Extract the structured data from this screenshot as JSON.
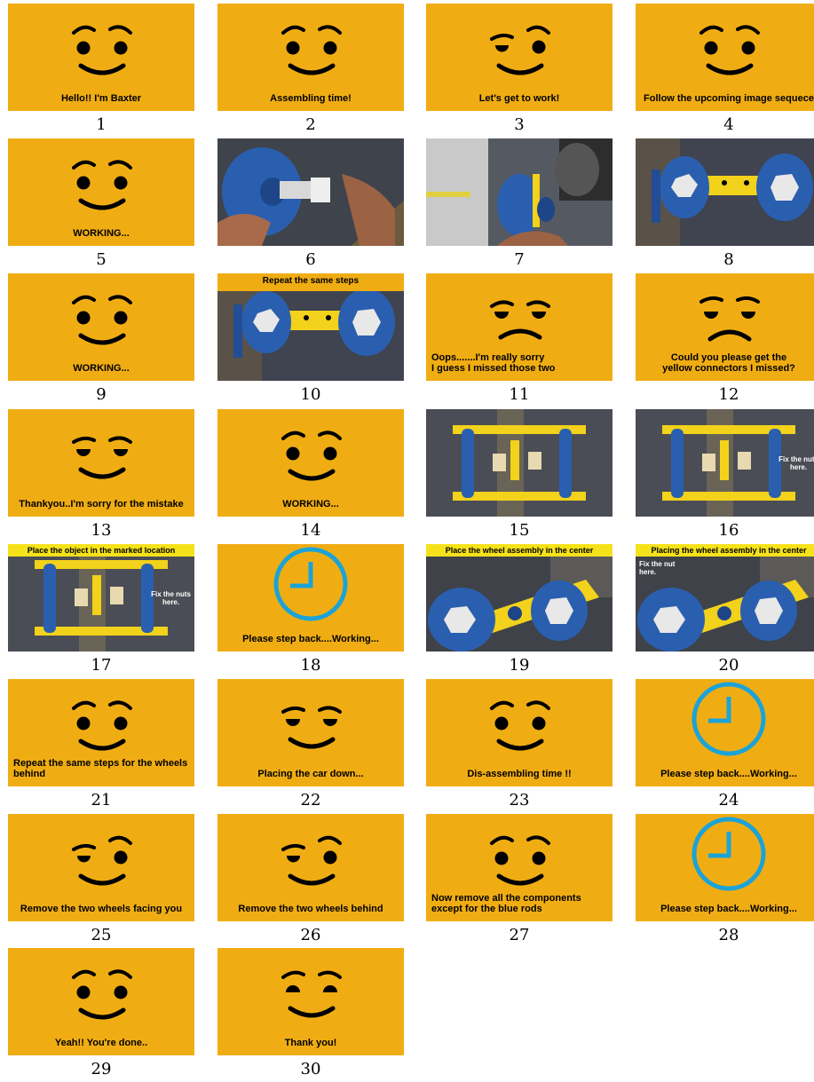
{
  "frames": [
    {
      "n": "1",
      "kind": "face",
      "expr": "happy",
      "caption": "Hello!! I'm Baxter"
    },
    {
      "n": "2",
      "kind": "face",
      "expr": "happy",
      "caption": "Assembling time!"
    },
    {
      "n": "3",
      "kind": "face",
      "expr": "wink",
      "caption": "Let's get to work!"
    },
    {
      "n": "4",
      "kind": "face",
      "expr": "happy",
      "caption": "Follow the upcoming image sequece"
    },
    {
      "n": "5",
      "kind": "face",
      "expr": "happy",
      "caption": "WORKING..."
    },
    {
      "n": "6",
      "kind": "photo",
      "scene": "wheel-bolt"
    },
    {
      "n": "7",
      "kind": "photo",
      "scene": "wheel-robot"
    },
    {
      "n": "8",
      "kind": "photo",
      "scene": "wheels-pair"
    },
    {
      "n": "9",
      "kind": "face",
      "expr": "happy",
      "caption": "WORKING..."
    },
    {
      "n": "10",
      "kind": "photo",
      "scene": "wheels-pair",
      "banner": "Repeat the same steps",
      "banner_style": "orange"
    },
    {
      "n": "11",
      "kind": "face",
      "expr": "sad",
      "caption": "Oops.......I'm really sorry\nI guess I missed those two",
      "align": "left"
    },
    {
      "n": "12",
      "kind": "face",
      "expr": "sad-closed",
      "caption": "Could you please get the\nyellow connectors I missed?"
    },
    {
      "n": "13",
      "kind": "face",
      "expr": "sheepish",
      "caption": "Thankyou..I'm sorry for the mistake"
    },
    {
      "n": "14",
      "kind": "face",
      "expr": "happy",
      "caption": "WORKING..."
    },
    {
      "n": "15",
      "kind": "photo",
      "scene": "frame-top"
    },
    {
      "n": "16",
      "kind": "photo",
      "scene": "frame-top",
      "annot": "Fix the nuts\nhere."
    },
    {
      "n": "17",
      "kind": "photo",
      "scene": "frame-top",
      "banner": "Place the object in the marked location",
      "annot": "Fix the nuts\nhere."
    },
    {
      "n": "18",
      "kind": "clock",
      "caption": "Please step back....Working..."
    },
    {
      "n": "19",
      "kind": "photo",
      "scene": "wheels-center",
      "banner": "Place the wheel assembly in the center"
    },
    {
      "n": "20",
      "kind": "photo",
      "scene": "wheels-center",
      "banner": "Placing the wheel assembly in the center",
      "annot": "Fix the nut\nhere."
    },
    {
      "n": "21",
      "kind": "face",
      "expr": "happy",
      "caption": "Repeat the same steps for the wheels\nbehind",
      "align": "left"
    },
    {
      "n": "22",
      "kind": "face",
      "expr": "sheepish",
      "caption": "Placing the car down..."
    },
    {
      "n": "23",
      "kind": "face",
      "expr": "happy",
      "caption": "Dis-assembling time !!"
    },
    {
      "n": "24",
      "kind": "clock",
      "caption": "Please step back....Working..."
    },
    {
      "n": "25",
      "kind": "face",
      "expr": "wink",
      "caption": "Remove the two wheels facing you"
    },
    {
      "n": "26",
      "kind": "face",
      "expr": "wink",
      "caption": "Remove the two wheels behind"
    },
    {
      "n": "27",
      "kind": "face",
      "expr": "happy",
      "caption": "Now remove all the components\nexcept for the blue rods",
      "align": "left"
    },
    {
      "n": "28",
      "kind": "clock",
      "caption": "Please step back....Working..."
    },
    {
      "n": "29",
      "kind": "face",
      "expr": "happy",
      "caption": "Yeah!! You're done.."
    },
    {
      "n": "30",
      "kind": "face",
      "expr": "half-closed",
      "caption": "Thank you!"
    }
  ],
  "colors": {
    "panel": "#f0ad13",
    "clock": "#1ba3d8",
    "banner": "#f6e21a",
    "wheel": "#2a5fb0",
    "frame": "#f2d21a"
  }
}
